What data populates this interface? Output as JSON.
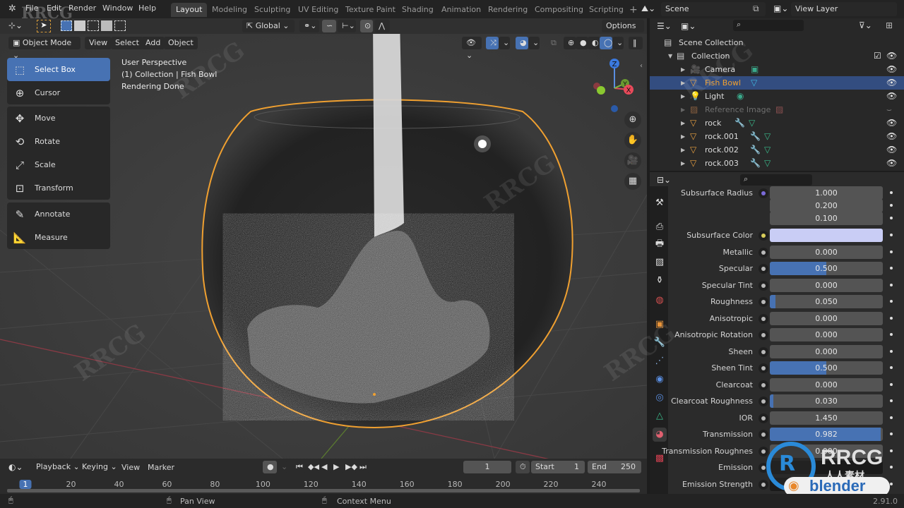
{
  "topbar": {
    "menus": [
      "File",
      "Edit",
      "Render",
      "Window",
      "Help"
    ],
    "workspaces": [
      "Layout",
      "Modeling",
      "Sculpting",
      "UV Editing",
      "Texture Paint",
      "Shading",
      "Animation",
      "Rendering",
      "Compositing",
      "Scripting"
    ],
    "active_workspace": "Layout",
    "add_tab": "+",
    "scene": "Scene",
    "view_layer": "View Layer"
  },
  "viewport": {
    "mode": "Object Mode",
    "menus": [
      "View",
      "Select",
      "Add",
      "Object"
    ],
    "orientation": "Global",
    "options": "Options",
    "overlay": [
      "User Perspective",
      "(1) Collection | Fish Bowl",
      "Rendering Done"
    ],
    "gizmo_axes": [
      "Z",
      "Y",
      "X"
    ],
    "tools": [
      {
        "label": "Select Box",
        "icon": "select-box-icon",
        "active": true
      },
      {
        "label": "Cursor",
        "icon": "cursor-icon"
      },
      {
        "label": "Move",
        "icon": "move-icon"
      },
      {
        "label": "Rotate",
        "icon": "rotate-icon"
      },
      {
        "label": "Scale",
        "icon": "scale-icon"
      },
      {
        "label": "Transform",
        "icon": "transform-icon"
      },
      {
        "label": "Annotate",
        "icon": "annotate-icon"
      },
      {
        "label": "Measure",
        "icon": "measure-icon"
      }
    ]
  },
  "outliner": {
    "root": "Scene Collection",
    "collection": "Collection",
    "items": [
      {
        "name": "Camera",
        "icon": "camera-icon"
      },
      {
        "name": "Fish Bowl",
        "icon": "mesh-icon",
        "selected": true
      },
      {
        "name": "Light",
        "icon": "light-icon"
      },
      {
        "name": "Reference Image",
        "icon": "image-icon",
        "hidden": true
      },
      {
        "name": "rock",
        "icon": "mesh-icon"
      },
      {
        "name": "rock.001",
        "icon": "mesh-icon"
      },
      {
        "name": "rock.002",
        "icon": "mesh-icon"
      },
      {
        "name": "rock.003",
        "icon": "mesh-icon"
      }
    ]
  },
  "properties": {
    "rows": [
      {
        "label": "Subsurface Radius",
        "value": "1.000",
        "dot": "purple"
      },
      {
        "label": "",
        "value": "0.200"
      },
      {
        "label": "",
        "value": "0.100"
      },
      {
        "label": "Subsurface Color",
        "value": "",
        "dot": "yellow",
        "color": "#c9cdf5"
      },
      {
        "label": "Metallic",
        "value": "0.000",
        "fill": 0
      },
      {
        "label": "Specular",
        "value": "0.500",
        "fill": 0.5
      },
      {
        "label": "Specular Tint",
        "value": "0.000",
        "fill": 0
      },
      {
        "label": "Roughness",
        "value": "0.050",
        "fill": 0.05
      },
      {
        "label": "Anisotropic",
        "value": "0.000",
        "fill": 0
      },
      {
        "label": "Anisotropic Rotation",
        "value": "0.000",
        "fill": 0
      },
      {
        "label": "Sheen",
        "value": "0.000",
        "fill": 0
      },
      {
        "label": "Sheen Tint",
        "value": "0.500",
        "fill": 0.5
      },
      {
        "label": "Clearcoat",
        "value": "0.000",
        "fill": 0
      },
      {
        "label": "Clearcoat Roughness",
        "value": "0.030",
        "fill": 0.03
      },
      {
        "label": "IOR",
        "value": "1.450"
      },
      {
        "label": "Transmission",
        "value": "0.982",
        "fill": 0.982
      },
      {
        "label": "Transmission Roughnes",
        "value": "0.000",
        "fill": 0
      },
      {
        "label": "Emission",
        "value": ""
      },
      {
        "label": "Emission Strength",
        "value": ""
      }
    ]
  },
  "timeline": {
    "menus": [
      "Playback",
      "Keying",
      "View",
      "Marker"
    ],
    "current_frame": "1",
    "start_label": "Start",
    "start": "1",
    "end_label": "End",
    "end": "250",
    "ticks": [
      "1",
      "20",
      "40",
      "60",
      "80",
      "100",
      "120",
      "140",
      "160",
      "180",
      "200",
      "220",
      "240"
    ]
  },
  "statusbar": {
    "pan": "Pan View",
    "context": "Context Menu",
    "version": "2.91.0"
  },
  "watermark": {
    "text": "RRCG",
    "sub": "人人素材",
    "brand": "blender"
  },
  "colors": {
    "accent": "#4772b3",
    "selection": "#f0a030",
    "panel": "#2b2b2b"
  }
}
